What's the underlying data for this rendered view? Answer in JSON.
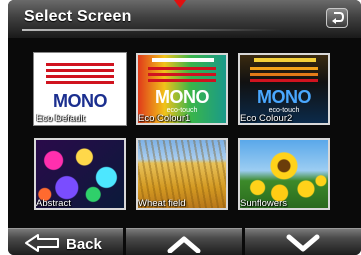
{
  "header": {
    "title": "Select Screen",
    "return_icon": "return-arrow-icon"
  },
  "tiles": [
    {
      "label": "Eco Default",
      "mono_text": "MONO",
      "selected": true
    },
    {
      "label": "Eco Colour1",
      "mono_text": "MONO",
      "eco_text": "eco-touch",
      "selected": false
    },
    {
      "label": "Eco Colour2",
      "mono_text": "MONO",
      "eco_text": "eco-touch",
      "selected": false
    },
    {
      "label": "Abstract",
      "selected": false
    },
    {
      "label": "Wheat field",
      "selected": false
    },
    {
      "label": "Sunflowers",
      "selected": false
    }
  ],
  "nav": {
    "back_label": "Back",
    "back_icon": "back-arrow-icon",
    "up_icon": "chevron-up-icon",
    "down_icon": "chevron-down-icon"
  },
  "colors": {
    "mono_red": "#d0131f",
    "mono_blue": "#1b2f8f",
    "panel_bg": "#0a0a0a"
  }
}
